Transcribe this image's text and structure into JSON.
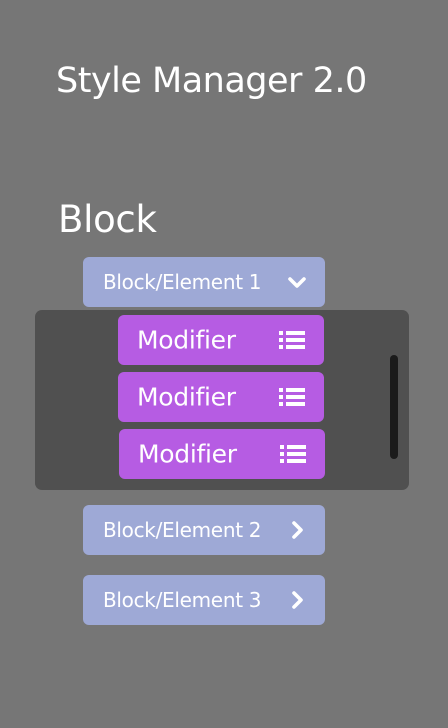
{
  "app": {
    "title": "Style Manager 2.0"
  },
  "section": {
    "heading": "Block"
  },
  "elements": [
    {
      "label": "Block/Element 1",
      "expanded": true,
      "chevron_icon": "chevron-down-icon"
    },
    {
      "label": "Block/Element 2",
      "expanded": false,
      "chevron_icon": "chevron-right-icon"
    },
    {
      "label": "Block/Element 3",
      "expanded": false,
      "chevron_icon": "chevron-right-icon"
    }
  ],
  "modifiers": [
    {
      "label": "Modifier",
      "icon": "list-icon"
    },
    {
      "label": "Modifier",
      "icon": "list-icon"
    },
    {
      "label": "Modifier",
      "icon": "list-icon"
    }
  ],
  "colors": {
    "background": "#767676",
    "element_button": "#9ea9d6",
    "modifier_button": "#b65ce3",
    "panel": "#505050",
    "text": "#ffffff"
  }
}
